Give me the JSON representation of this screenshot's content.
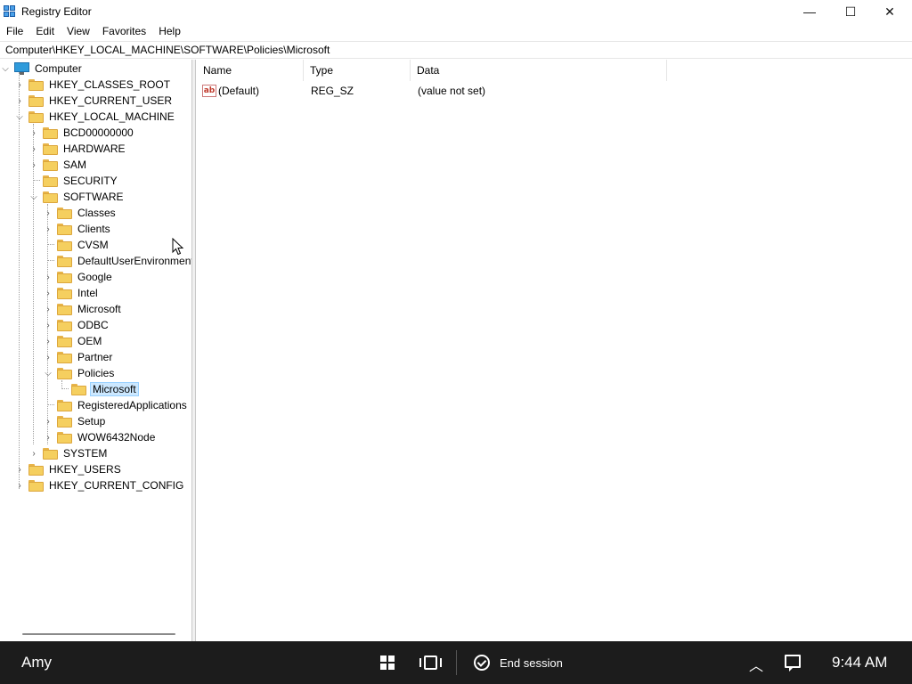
{
  "window": {
    "title": "Registry Editor",
    "icon": "registry-editor-icon",
    "controls": {
      "minimize": "—",
      "maximize": "☐",
      "close": "✕"
    }
  },
  "menu": [
    "File",
    "Edit",
    "View",
    "Favorites",
    "Help"
  ],
  "address": "Computer\\HKEY_LOCAL_MACHINE\\SOFTWARE\\Policies\\Microsoft",
  "tree": {
    "root": "Computer",
    "nodes": [
      "HKEY_CLASSES_ROOT",
      "HKEY_CURRENT_USER",
      "HKEY_LOCAL_MACHINE",
      "BCD00000000",
      "HARDWARE",
      "SAM",
      "SECURITY",
      "SOFTWARE",
      "Classes",
      "Clients",
      "CVSM",
      "DefaultUserEnvironment",
      "Google",
      "Intel",
      "Microsoft",
      "ODBC",
      "OEM",
      "Partner",
      "Policies",
      "Microsoft",
      "RegisteredApplications",
      "Setup",
      "WOW6432Node",
      "SYSTEM",
      "HKEY_USERS",
      "HKEY_CURRENT_CONFIG"
    ],
    "selected": "Microsoft"
  },
  "list": {
    "columns": [
      "Name",
      "Type",
      "Data"
    ],
    "rows": [
      {
        "icon": "string-value-icon",
        "icon_text": "ab",
        "name": "(Default)",
        "type": "REG_SZ",
        "data": "(value not set)"
      }
    ]
  },
  "taskbar": {
    "user": "Amy",
    "end_session": "End session",
    "time": "9:44 AM"
  }
}
